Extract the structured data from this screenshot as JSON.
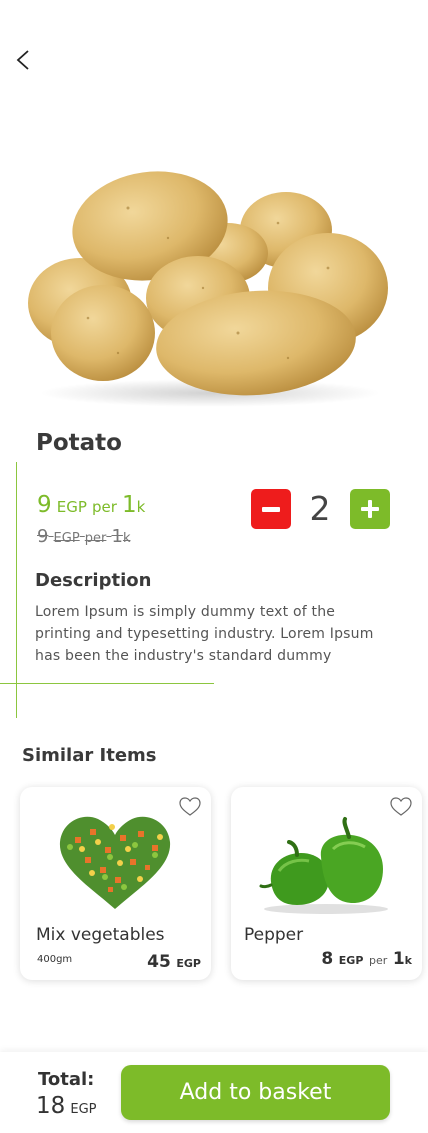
{
  "header": {
    "back_icon": "chevron-left-icon"
  },
  "product": {
    "name": "Potato",
    "price": {
      "amount": "9",
      "currency": "EGP",
      "per": "per",
      "unit_amount": "1",
      "unit": "k"
    },
    "old_price": {
      "amount": "9",
      "currency": "EGP",
      "per": "per",
      "unit_amount": "1",
      "unit": "k"
    },
    "quantity": "2",
    "description_heading": "Description",
    "description": "Lorem Ipsum is simply dummy text of the printing and typesetting industry. Lorem Ipsum has been the industry's standard dummy"
  },
  "similar": {
    "heading": "Similar Items",
    "items": [
      {
        "name": "Mix vegetables",
        "weight": "400gm",
        "price": "45",
        "currency": "EGP"
      },
      {
        "name": "Pepper",
        "price": "8",
        "currency": "EGP",
        "per": "per",
        "unit_amount": "1",
        "unit": "k"
      }
    ]
  },
  "footer": {
    "total_label": "Total:",
    "total_amount": "18",
    "total_currency": "EGP",
    "button_label": "Add to basket"
  },
  "colors": {
    "accent": "#7dbb29",
    "danger": "#ee1c1c",
    "text": "#333333"
  }
}
